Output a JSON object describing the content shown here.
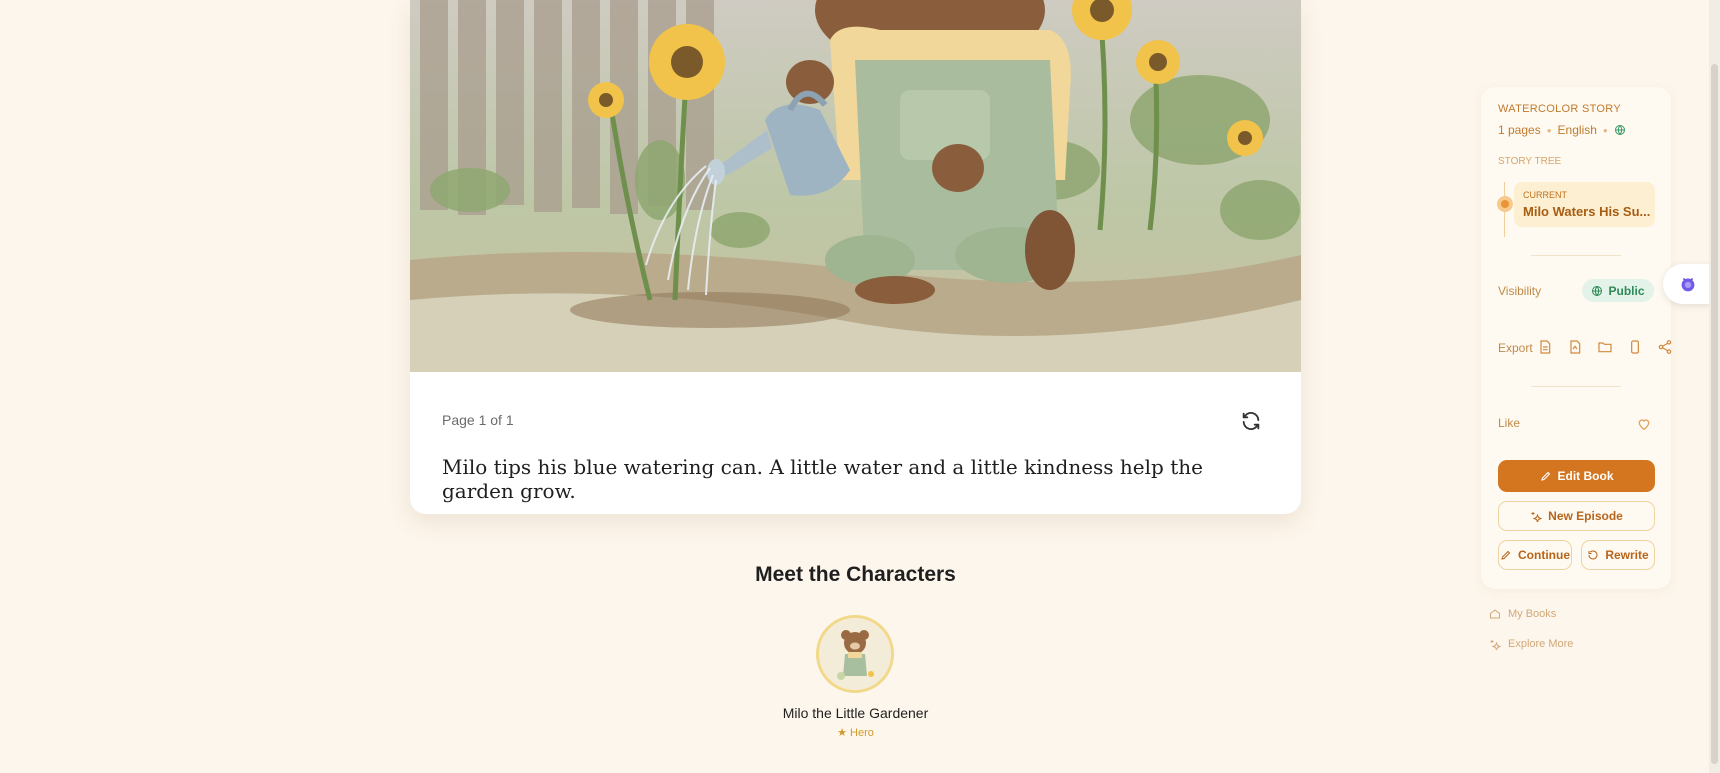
{
  "story": {
    "page_label": "Page 1 of 1",
    "text": "Milo tips his blue watering can. A little water and a little kindness help the garden grow.",
    "illustration_icon": "watercolor-bear-watering-sunflowers-illustration"
  },
  "characters": {
    "title": "Meet the Characters",
    "items": [
      {
        "name": "Milo the Little Gardener",
        "role": "★ Hero",
        "avatar_icon": "bear-avatar-icon"
      }
    ]
  },
  "side_panel": {
    "title": "WATERCOLOR STORY",
    "pages": "1 pages",
    "language": "English",
    "globe_icon": "globe-icon",
    "tree_label": "STORY TREE",
    "current_tag": "CURRENT",
    "current_title": "Milo Waters His Su...",
    "visibility_label": "Visibility",
    "visibility_value": "Public",
    "export_label": "Export",
    "export_icons": [
      "document-icon",
      "pdf-icon",
      "folder-icon",
      "phone-icon",
      "share-icon"
    ],
    "like_label": "Like",
    "buttons": {
      "edit": "Edit Book",
      "new_episode": "New Episode",
      "continue": "Continue",
      "rewrite": "Rewrite"
    }
  },
  "links": {
    "my_books": "My Books",
    "explore_more": "Explore More"
  },
  "colors": {
    "background": "#fdf6ec",
    "accent": "#d4761f",
    "public_badge": "#e3f3ea"
  }
}
